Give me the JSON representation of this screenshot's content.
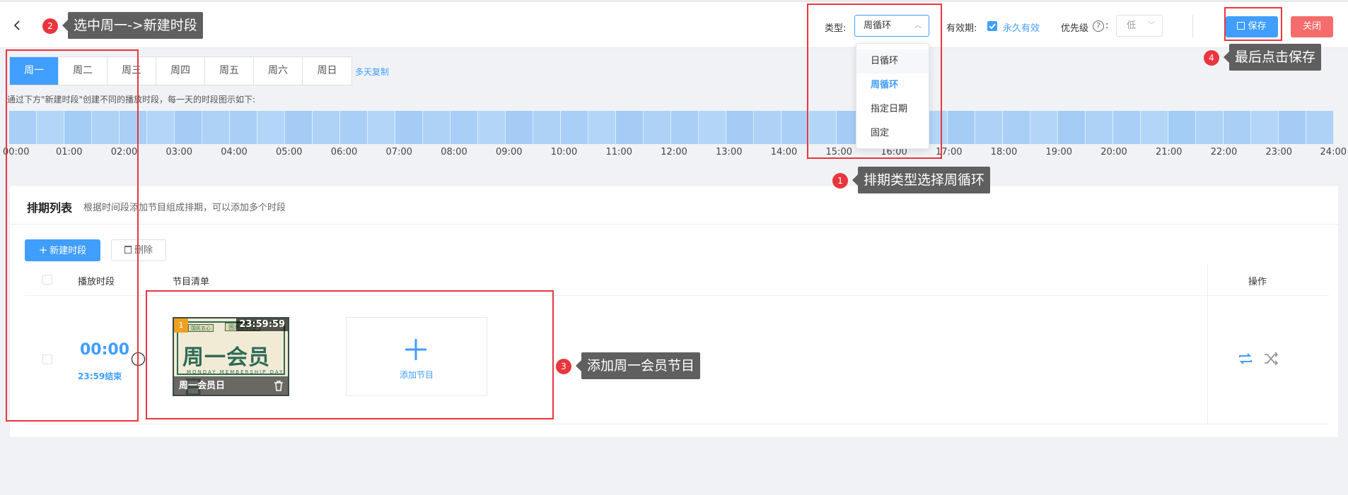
{
  "header": {
    "type_label": "类型:",
    "type_value": "周循环",
    "validity_label": "有效期:",
    "validity_value": "永久有效",
    "priority_label": "优先级",
    "priority_help": "?",
    "priority_colon": ":",
    "priority_value": "低",
    "save_label": "保存",
    "close_label": "关闭"
  },
  "type_dropdown": {
    "options": [
      "日循环",
      "周循环",
      "指定日期",
      "固定"
    ],
    "selected": "周循环"
  },
  "day_tabs": [
    "周一",
    "周二",
    "周三",
    "周四",
    "周五",
    "周六",
    "周日"
  ],
  "active_day": "周一",
  "copy_link": "多天复制",
  "hint": "通过下方\"新建时段\"创建不同的播放时段，每一天的时段图示如下:",
  "timeline": {
    "ticks": [
      "00:00",
      "01:00",
      "02:00",
      "03:00",
      "04:00",
      "05:00",
      "06:00",
      "07:00",
      "08:00",
      "09:00",
      "10:00",
      "11:00",
      "12:00",
      "13:00",
      "14:00",
      "15:00",
      "16:00",
      "17:00",
      "18:00",
      "19:00",
      "20:00",
      "21:00",
      "22:00",
      "23:00",
      "24:00"
    ]
  },
  "schedule": {
    "title": "排期列表",
    "description": "根据时间段添加节目组成排期，可以添加多个时段",
    "new_button": "新建时段",
    "delete_button": "删除",
    "columns": [
      "播放时段",
      "节目清单",
      "操作"
    ],
    "rows": [
      {
        "start": "00:00",
        "end": "23:59结束",
        "program": {
          "index": "1",
          "duration": "23:59:59",
          "name": "周一会员日",
          "artwork_title": "周一会员日",
          "artwork_subtitle": "MONDAY MEMBERSHIP DAY",
          "artwork_tag_left": "国民五心",
          "artwork_tag_mid": "国潮鲜帆主"
        },
        "add_label": "添加节目"
      }
    ]
  },
  "annotations": [
    {
      "number": "1",
      "text": "排期类型选择周循环"
    },
    {
      "number": "2",
      "text": "选中周一->新建时段"
    },
    {
      "number": "3",
      "text": "添加周一会员节目"
    },
    {
      "number": "4",
      "text": "最后点击保存"
    }
  ],
  "colors": {
    "primary": "#409eff",
    "danger": "#f56c6c",
    "annotation_red": "#e8363f",
    "timeline_fill": "#a9cff6"
  }
}
